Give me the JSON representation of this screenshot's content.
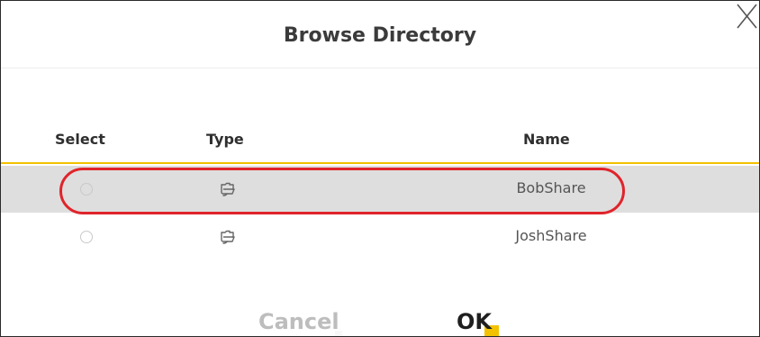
{
  "dialog": {
    "title": "Browse Directory",
    "close_icon": "close-icon"
  },
  "table": {
    "headers": {
      "select": "Select",
      "type": "Type",
      "name": "Name"
    },
    "rows": [
      {
        "name": "BobShare",
        "type_icon": "folder-share-icon",
        "selected": false,
        "highlighted": true
      },
      {
        "name": "JoshShare",
        "type_icon": "folder-share-icon",
        "selected": false,
        "highlighted": false
      }
    ]
  },
  "footer": {
    "cancel_label": "Cancel",
    "ok_label": "OK"
  },
  "colors": {
    "accent": "#f2c200",
    "annotation": "#e0242b",
    "row_highlight": "#dedede"
  }
}
